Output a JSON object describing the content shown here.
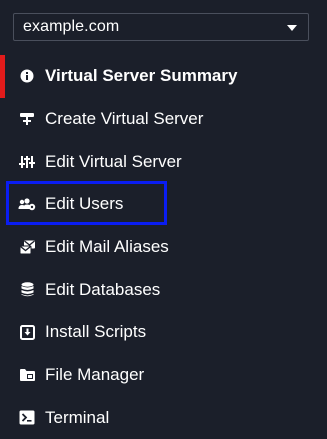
{
  "domain_select": {
    "value": "example.com"
  },
  "menu": {
    "items": [
      {
        "label": "Virtual Server Summary",
        "icon": "info-circle-icon",
        "active": true
      },
      {
        "label": "Create Virtual Server",
        "icon": "create-server-icon"
      },
      {
        "label": "Edit Virtual Server",
        "icon": "sliders-icon"
      },
      {
        "label": "Edit Users",
        "icon": "users-icon",
        "highlighted": true
      },
      {
        "label": "Edit Mail Aliases",
        "icon": "mail-alias-icon"
      },
      {
        "label": "Edit Databases",
        "icon": "database-icon"
      },
      {
        "label": "Install Scripts",
        "icon": "install-icon"
      },
      {
        "label": "File Manager",
        "icon": "folder-icon"
      },
      {
        "label": "Terminal",
        "icon": "terminal-icon"
      }
    ]
  },
  "colors": {
    "background": "#1b1f2a",
    "active_marker": "#e21b1b",
    "highlight_border": "#0a1df2",
    "text": "#ffffff"
  }
}
